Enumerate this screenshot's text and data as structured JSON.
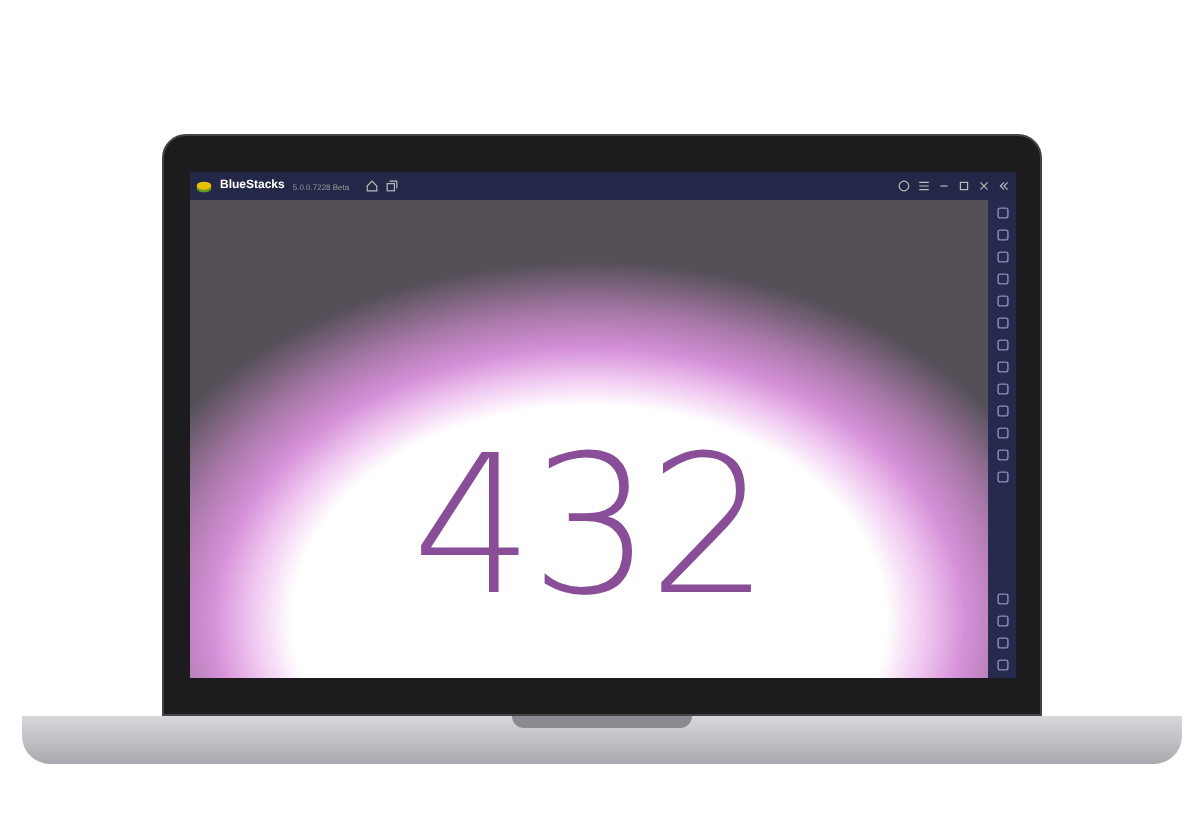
{
  "window": {
    "app_name": "BlueStacks",
    "version": "5.0.0.7228 Beta"
  },
  "screen": {
    "number": "432"
  }
}
